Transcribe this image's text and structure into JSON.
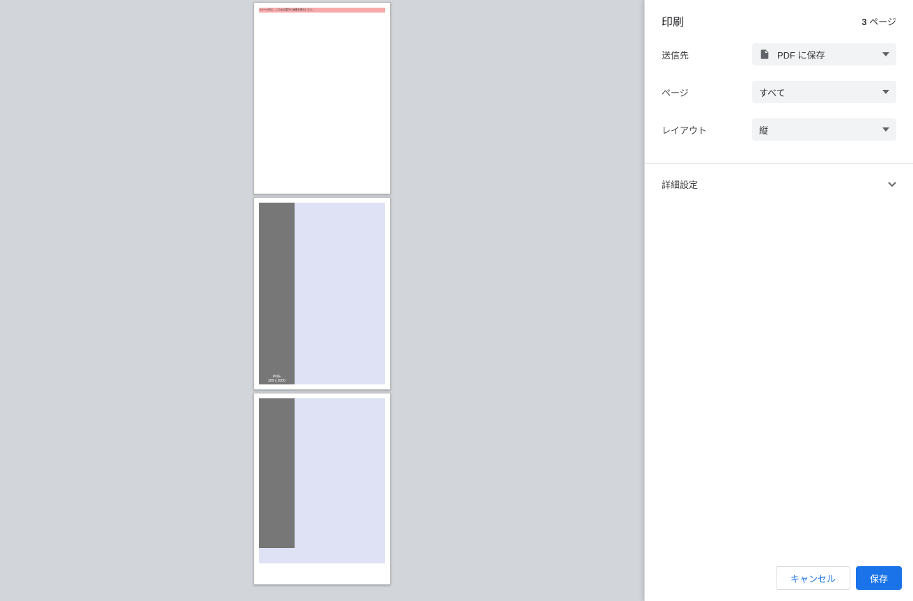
{
  "header": {
    "title": "印刷",
    "page_count_number": "3",
    "page_count_suffix": " ページ"
  },
  "settings": {
    "destination": {
      "label": "送信先",
      "value": "PDF に保存"
    },
    "pages": {
      "label": "ページ",
      "value": "すべて"
    },
    "layout": {
      "label": "レイアウト",
      "value": "縦"
    }
  },
  "advanced": {
    "label": "詳細設定"
  },
  "footer": {
    "cancel": "キャンセル",
    "save": "保存"
  },
  "preview": {
    "page1_highlight": "1ページ内に、この山の直下に画像を表示したい。",
    "image_tag": "PNG",
    "image_dims": "200 x 2000"
  }
}
